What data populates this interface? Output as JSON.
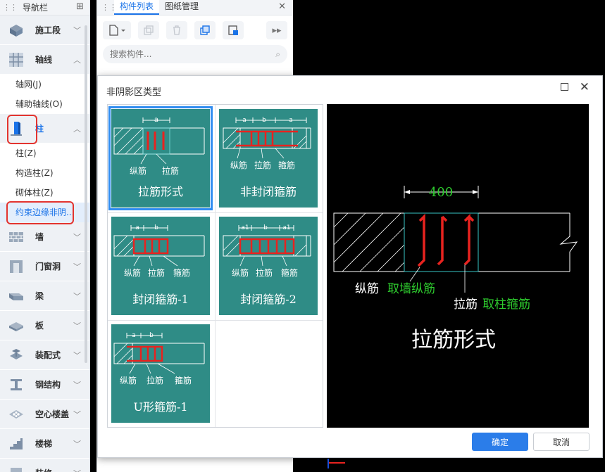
{
  "nav": {
    "title": "导航栏",
    "groups": [
      {
        "label": "施工段",
        "icon": "construction-stage-icon"
      },
      {
        "label": "轴线",
        "icon": "grid-axis-icon"
      },
      {
        "label": "柱",
        "icon": "column-icon"
      },
      {
        "label": "墙",
        "icon": "wall-icon"
      },
      {
        "label": "门窗洞",
        "icon": "door-window-icon"
      },
      {
        "label": "梁",
        "icon": "beam-icon"
      },
      {
        "label": "板",
        "icon": "slab-icon"
      },
      {
        "label": "装配式",
        "icon": "prefab-icon"
      },
      {
        "label": "钢结构",
        "icon": "steel-structure-icon"
      },
      {
        "label": "空心楼盖",
        "icon": "hollow-floor-icon"
      },
      {
        "label": "楼梯",
        "icon": "stair-icon"
      },
      {
        "label": "装修",
        "icon": "decoration-icon"
      }
    ],
    "axis_items": [
      "轴网(J)",
      "辅助轴线(O)"
    ],
    "column_items": [
      "柱(Z)",
      "构造柱(Z)",
      "砌体柱(Z)",
      "约束边缘非阴..."
    ]
  },
  "panel": {
    "tabs": [
      "构件列表",
      "图纸管理"
    ],
    "search_placeholder": "搜索构件..."
  },
  "dialog": {
    "title": "非阴影区类型",
    "options": [
      {
        "label": "拉筋形式",
        "dims": [
          "a"
        ],
        "rebars": [
          "纵筋",
          "拉筋"
        ]
      },
      {
        "label": "非封闭箍筋",
        "dims": [
          "a",
          "b",
          "a"
        ],
        "rebars": [
          "纵筋",
          "拉筋",
          "箍筋"
        ]
      },
      {
        "label": "封闭箍筋-1",
        "dims": [
          "a",
          "b"
        ],
        "rebars": [
          "纵筋",
          "拉筋",
          "箍筋"
        ]
      },
      {
        "label": "封闭箍筋-2",
        "dims": [
          "a1",
          "b",
          "a1"
        ],
        "rebars": [
          "纵筋",
          "拉筋",
          "箍筋"
        ]
      },
      {
        "label": "U形箍筋-1",
        "dims": [
          "a",
          "b"
        ],
        "rebars": [
          "纵筋",
          "拉筋",
          "箍筋"
        ]
      }
    ],
    "preview": {
      "dimension": "400",
      "longitudinal_label": "纵筋",
      "longitudinal_note": "取墙纵筋",
      "tie_label": "拉筋",
      "tie_note": "取柱箍筋",
      "caption": "拉筋形式"
    },
    "ok_label": "确定",
    "cancel_label": "取消"
  },
  "colors": {
    "accent": "#1a73e8",
    "option_bg": "#2f8c86",
    "rebar_red": "#e8231f",
    "note_green": "#2ecc2e",
    "highlight_red": "#e3342f"
  }
}
